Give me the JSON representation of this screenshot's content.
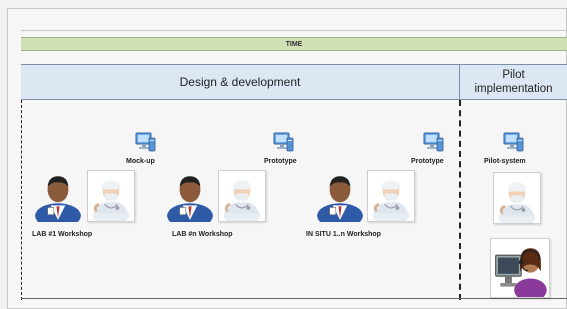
{
  "header": {
    "time_label": "TIME"
  },
  "phases": {
    "design": "Design & development",
    "pilot_line1": "Pilot",
    "pilot_line2": "implementation"
  },
  "artifacts": {
    "mockup": "Mock-up",
    "prototype1": "Prototype",
    "prototype2": "Prototype",
    "pilot_system": "Pilot-system"
  },
  "workshops": {
    "lab1": "LAB #1 Workshop",
    "labn": "LAB #n Workshop",
    "insitu": "IN SITU 1..n  Workshop"
  },
  "colors": {
    "time_bar": "#cfe0b5",
    "phase_row": "#dde7f4",
    "suit_blue": "#2e5aa8",
    "computer_blue": "#4a8bd6"
  },
  "icons": [
    "computer-icon",
    "businessman-icon",
    "doctor-icon",
    "call-center-operator-icon"
  ]
}
